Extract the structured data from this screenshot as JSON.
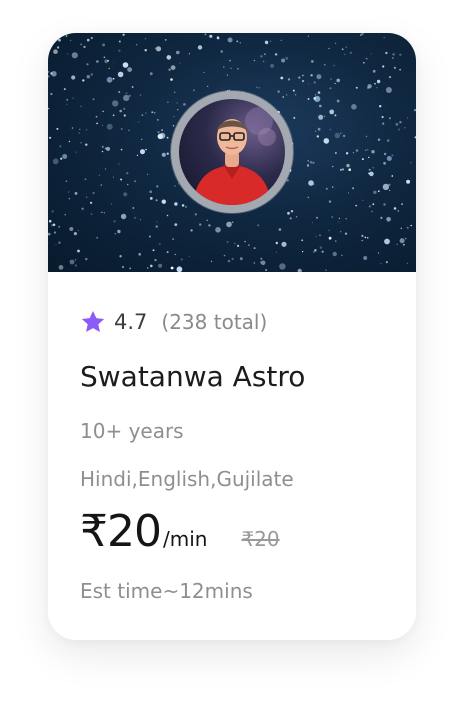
{
  "astrologer": {
    "name": "Swatanwa Astro",
    "rating": "4.7",
    "rating_count": "(238 total)",
    "experience": "10+ years",
    "languages": "Hindi,English,Gujilate",
    "price": "₹20",
    "price_unit": "/min",
    "original_price": "₹20",
    "est_time": "Est time~12mins"
  },
  "icons": {
    "rating": "star-icon"
  },
  "colors": {
    "star": "#8b5cf6",
    "banner": "#0f2740",
    "avatar_ring": "#a4a8b0",
    "shirt": "#d92a2a"
  }
}
